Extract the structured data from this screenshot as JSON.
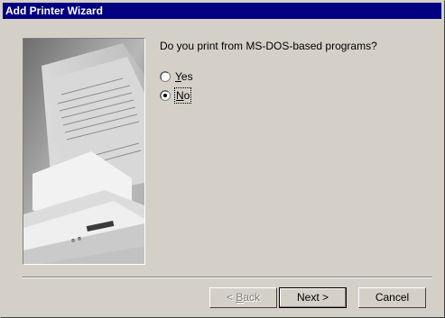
{
  "window": {
    "title": "Add Printer Wizard"
  },
  "content": {
    "question": "Do you print from MS-DOS-based programs?",
    "options": [
      {
        "key": "Y",
        "rest": "es",
        "selected": false
      },
      {
        "key": "N",
        "rest": "o",
        "selected": true
      }
    ]
  },
  "buttons": {
    "back": {
      "key": "B",
      "rest": "ack",
      "prefix": "< ",
      "enabled": false
    },
    "next": {
      "label": "Next >"
    },
    "cancel": {
      "label": "Cancel"
    }
  },
  "colors": {
    "titlebar": "#000080",
    "face": "#d4d0c8"
  },
  "icons": [
    "radio-unselected-icon",
    "radio-selected-icon",
    "printer-illustration"
  ]
}
